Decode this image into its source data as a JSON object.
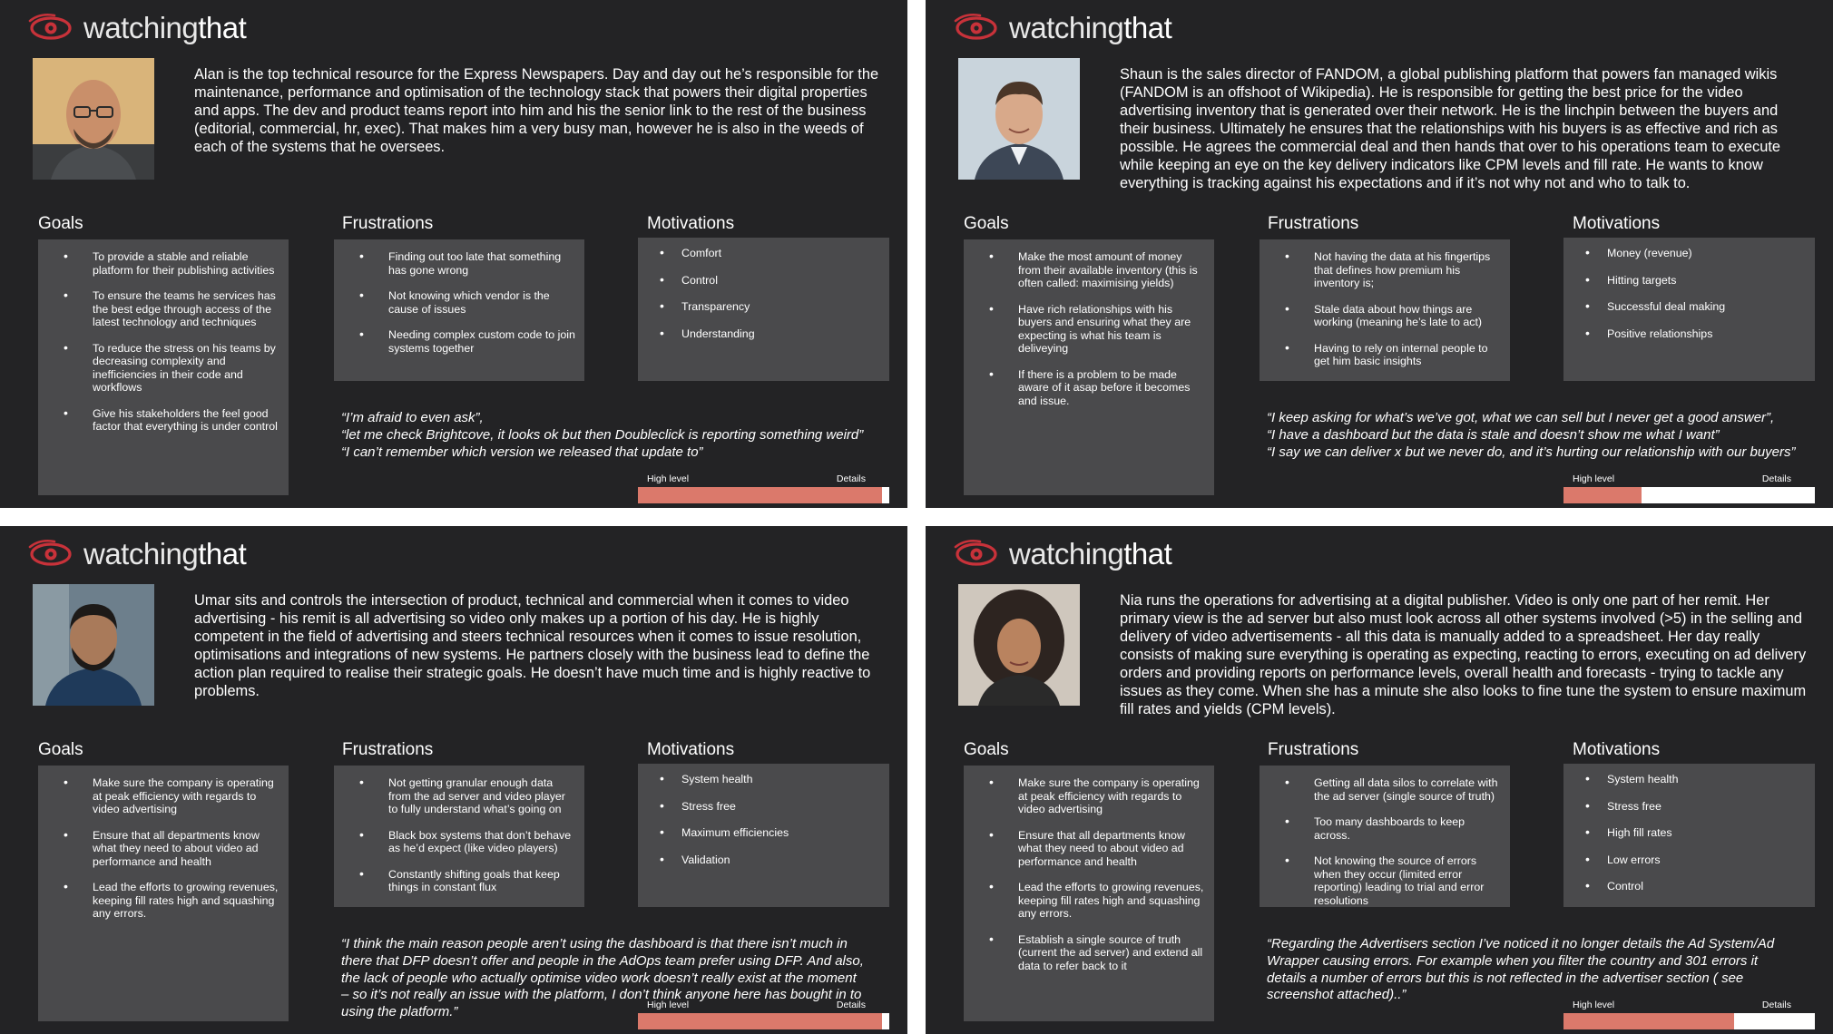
{
  "brand": {
    "logo_light": "watching",
    "logo_bold": "that",
    "accent_color": "#c8323a",
    "bar_color": "#db796b"
  },
  "section_titles": {
    "goals": "Goals",
    "frustrations": "Frustrations",
    "motivations": "Motivations"
  },
  "scale_labels": {
    "low": "High level",
    "high": "Details"
  },
  "personas": [
    {
      "photo": "bald-man-with-glasses-photo",
      "bio": "Alan is the top technical resource for the Express Newspapers. Day and day out he’s responsible for the maintenance, performance and optimisation of the technology stack that powers their digital properties and apps. The dev and product teams report into him and his the senior link to the rest of the business (editorial, commercial, hr, exec). That makes him a very busy man, however he is also in the weeds of each of the systems that he oversees.",
      "goals": [
        "To provide a stable and reliable platform for their publishing activities",
        "To ensure the teams he services has the best edge through access of the latest technology and techniques",
        "To reduce the stress on his teams by decreasing complexity and inefficiencies in their code and workflows",
        "Give his stakeholders the feel good factor that everything is under control"
      ],
      "frustrations": [
        "Finding out too late that something has gone wrong",
        "Not knowing which vendor is the cause of issues",
        "Needing complex custom code to join systems together"
      ],
      "motivations": [
        "Comfort",
        "Control",
        "Transparency",
        "Understanding"
      ],
      "quote_lines": [
        "“I’m afraid to even ask”,",
        "“let me check Brightcove, it looks ok but then Doubleclick is reporting something weird”",
        "“I can’t remember which version we released that update to”"
      ],
      "detail_level": 0.97
    },
    {
      "photo": "man-in-suit-photo",
      "bio": "Shaun is the sales director of FANDOM, a global publishing platform that powers fan managed wikis (FANDOM is an offshoot of Wikipedia). He is responsible for getting the best price for the video advertising inventory that is generated over their network.  He is the linchpin between the buyers and their business. Ultimately he ensures that the relationships with his buyers is as effective and rich as possible.  He agrees the commercial deal and then hands that over to his operations team to execute while keeping an eye on the key delivery indicators like CPM levels and fill rate.  He wants to know everything is tracking against his expectations and if it’s not why not and who to talk to.",
      "goals": [
        "Make the most amount of money from their available inventory (this is often called: maximising yields)",
        "Have rich relationships with his buyers and ensuring what they are expecting is what his team is deliveying",
        "If there is a problem to be made aware of it asap before it becomes and issue."
      ],
      "frustrations": [
        "Not having the data at his fingertips that defines how premium his inventory is;",
        "Stale data about how things are working (meaning he’s late to act)",
        "Having to rely on internal people to get him basic insights"
      ],
      "motivations": [
        "Money (revenue)",
        "Hitting targets",
        "Successful deal making",
        "Positive relationships"
      ],
      "quote_lines": [
        "“I keep asking for what’s we’ve got, what we can sell but I never get a good answer”,",
        "“I have a dashboard but the data is stale and doesn’t show me what I want”",
        "“I say we can deliver x but we never do, and it’s hurting our relationship with our buyers”"
      ],
      "detail_level": 0.31
    },
    {
      "photo": "bearded-man-photo",
      "bio": "Umar sits and controls the intersection of product, technical and commercial when it comes to video advertising - his remit is all advertising so video only makes up a portion of his day.  He is highly competent in the field of advertising and steers technical resources when it comes to issue resolution, optimisations and integrations of new systems.  He partners closely with the business lead to define the action plan required to realise their strategic goals.  He doesn’t have much time and is highly reactive to problems.",
      "goals": [
        "Make sure the company is operating at peak efficiency with regards to video advertising",
        "Ensure that all departments know what they need to about video ad performance and health",
        "Lead the efforts to growing revenues, keeping fill rates high and squashing any errors."
      ],
      "frustrations": [
        "Not getting granular enough data from the ad server and video player to fully understand what’s going on",
        "Black box systems that don’t behave as he’d expect (like video players)",
        "Constantly shifting goals that keep things in constant flux"
      ],
      "motivations": [
        "System health",
        "Stress free",
        "Maximum efficiencies",
        "Validation"
      ],
      "quote_lines": [
        "“I think the main reason people aren’t using the dashboard is that there isn’t much in",
        "there that DFP doesn’t offer and people in the AdOps team prefer using DFP. And also,",
        "the lack of people who actually optimise video work doesn’t really exist at the moment",
        "– so it’s not really an issue with the platform, I don’t think anyone here has bought in to",
        "using the platform.”"
      ],
      "detail_level": 0.97
    },
    {
      "photo": "woman-with-curly-hair-photo",
      "bio": "Nia runs the operations for advertising at a digital publisher.  Video is only one part of her remit.  Her primary view is the ad server but also must look across all other systems involved (>5) in the selling and delivery of video advertisements - all this data is manually added to a spreadsheet. Her day really consists of making sure everything is operating as expecting, reacting to errors, executing on ad delivery orders and providing reports on performance levels, overall health and forecasts - trying to tackle any issues as they come.  When she has a minute she also looks to fine tune the system to ensure maximum fill rates and yields (CPM levels).",
      "goals": [
        "Make sure the company is operating at peak efficiency with regards to video advertising",
        "Ensure that all departments know what they need to about video ad performance and health",
        "Lead the efforts to growing revenues, keeping fill rates high and squashing any errors.",
        "Establish a single source of truth (current the ad server) and extend all data to refer back to it"
      ],
      "frustrations": [
        "Getting all data silos to correlate with the ad server (single source of truth)",
        "Too many dashboards to keep across.",
        "Not knowing the source of errors when they occur (limited error reporting) leading to trial and error resolutions"
      ],
      "motivations": [
        "System health",
        "Stress free",
        "High fill rates",
        "Low errors",
        "Control"
      ],
      "quote_lines": [
        "“Regarding the Advertisers section I’ve noticed it no longer details the Ad System/Ad",
        "Wrapper causing errors. For example when you filter the country and 301 errors it",
        "details a number of errors but this is not reflected in the advertiser section ( see",
        "screenshot attached)..”"
      ],
      "detail_level": 0.68
    }
  ]
}
